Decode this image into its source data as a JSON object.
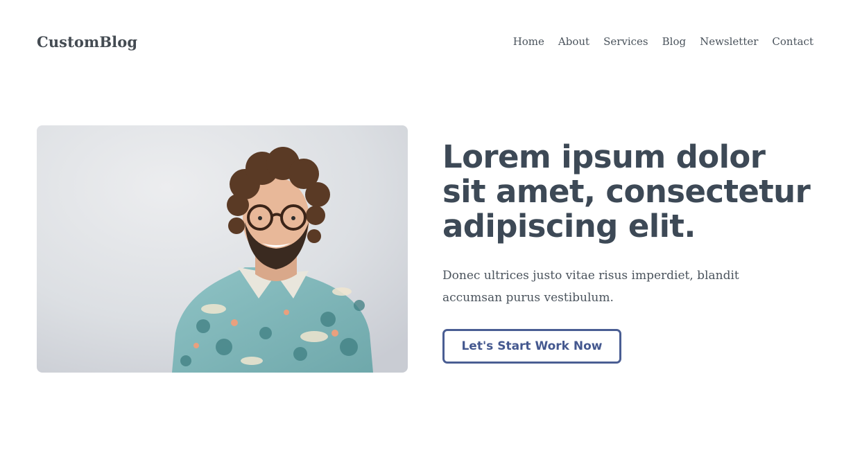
{
  "site": {
    "logo": "CustomBlog"
  },
  "nav": {
    "items": [
      "Home",
      "About",
      "Services",
      "Blog",
      "Newsletter",
      "Contact"
    ]
  },
  "hero": {
    "headline_lines": [
      "Lorem ipsum dolor",
      "sit amet, consectetur",
      "adipiscing elit."
    ],
    "subtext_lines": [
      "Donec ultrices justo vitae risus imperdiet, blandit",
      "accumsan purus vestibulum."
    ],
    "cta_label": "Let's Start Work Now"
  },
  "colors": {
    "text": "#3d4956",
    "accent": "#4a5e93",
    "background": "#ffffff"
  }
}
